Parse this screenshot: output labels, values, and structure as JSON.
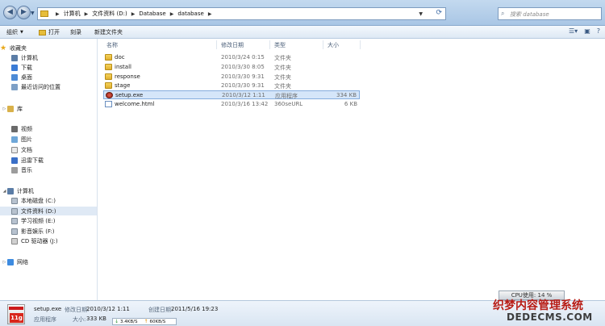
{
  "address": {
    "crumbs": [
      "计算机",
      "文件资料 (D:)",
      "Database",
      "database"
    ],
    "search_placeholder": "搜索 database"
  },
  "toolbar": {
    "organize": "组织",
    "open": "打开",
    "burn": "刻录",
    "new_folder": "新建文件夹"
  },
  "sidebar": {
    "favorites_header": "收藏夹",
    "favorites": [
      "计算机",
      "下载",
      "桌面",
      "最近访问的位置"
    ],
    "libraries_header": "库",
    "libraries": [
      "视频",
      "图片",
      "文档",
      "迅雷下载",
      "音乐"
    ],
    "computer_header": "计算机",
    "drives": [
      "本地磁盘 (C:)",
      "文件资料 (D:)",
      "学习视频 (E:)",
      "影音娱乐 (F:)",
      "CD 驱动器 (J:)"
    ],
    "network_header": "网络",
    "selected_drive": "文件资料 (D:)"
  },
  "columns": {
    "name": "名称",
    "date": "修改日期",
    "type": "类型",
    "size": "大小"
  },
  "files": [
    {
      "name": "doc",
      "date": "2010/3/24 0:15",
      "type": "文件夹",
      "size": "",
      "icon": "folder-icon"
    },
    {
      "name": "install",
      "date": "2010/3/30 8:05",
      "type": "文件夹",
      "size": "",
      "icon": "folder-icon"
    },
    {
      "name": "response",
      "date": "2010/3/30 9:31",
      "type": "文件夹",
      "size": "",
      "icon": "folder-icon"
    },
    {
      "name": "stage",
      "date": "2010/3/30 9:31",
      "type": "文件夹",
      "size": "",
      "icon": "folder-icon"
    },
    {
      "name": "setup.exe",
      "date": "2010/3/12 1:11",
      "type": "应用程序",
      "size": "334 KB",
      "icon": "setup-exe-icon",
      "selected": true
    },
    {
      "name": "welcome.html",
      "date": "2010/3/16 13:42",
      "type": "360seURL",
      "size": "6 KB",
      "icon": "html-file-icon"
    }
  ],
  "cpu_label": "CPU使用: 14 %",
  "details": {
    "icon_badge": "11g",
    "filename": "setup.exe",
    "modified_label": "修改日期:",
    "modified_value": "2010/3/12 1:11",
    "created_label": "创建日期:",
    "created_value": "2011/5/16 19:23",
    "type_value": "应用程序",
    "size_label": "大小:",
    "size_value": "333 KB"
  },
  "net_speed": {
    "down": "3.4KB/S",
    "up": "60KB/S"
  },
  "watermark": {
    "chinese": "织梦内容管理系统",
    "english": "DEDECMS.COM"
  }
}
